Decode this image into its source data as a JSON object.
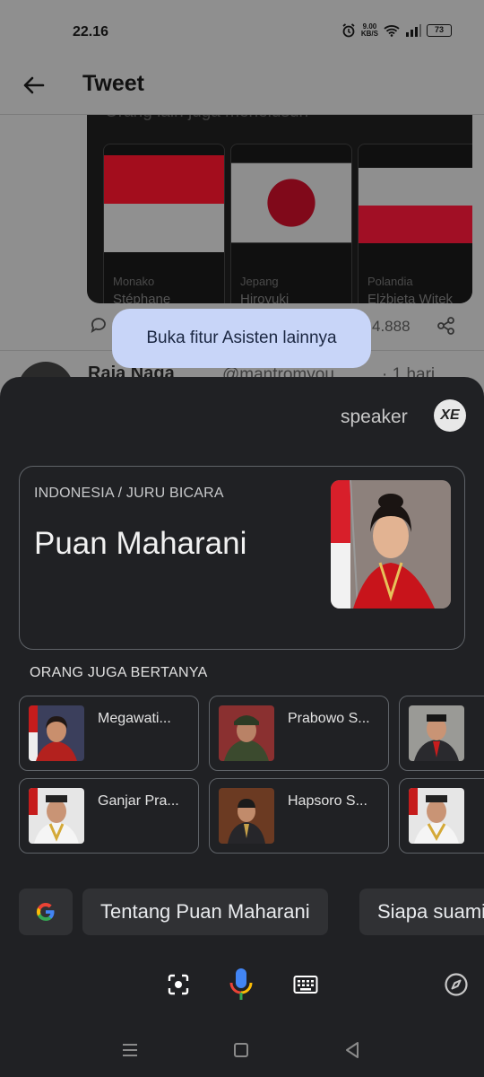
{
  "status_bar": {
    "time": "22.16",
    "net_speed_value": "9.00",
    "net_speed_unit": "KB/S",
    "battery": "73"
  },
  "top_bar": {
    "title": "Tweet"
  },
  "related_card": {
    "title": "Orang lain juga menelusuri",
    "items": [
      {
        "country": "Monako",
        "person": "Stéphane"
      },
      {
        "country": "Jepang",
        "person": "Hiroyuki"
      },
      {
        "country": "Polandia",
        "person": "Elżbieta Witek"
      }
    ]
  },
  "tweet_actions": {
    "views": "4.888"
  },
  "next_tweet": {
    "name": "Raja Naga",
    "handle": "@mantromyou",
    "time": "· 1 hari"
  },
  "tooltip": {
    "text": "Buka fitur Asisten lainnya"
  },
  "assistant": {
    "speaker_label": "speaker",
    "avatar_initials": "XE",
    "knowledge_panel": {
      "subtitle_country": "INDONESIA",
      "subtitle_role": "/ JURU BICARA",
      "name": "Puan Maharani"
    },
    "people_also_ask": {
      "title": "ORANG JUGA BERTANYA",
      "items": [
        {
          "label": "Megawati..."
        },
        {
          "label": "Prabowo S..."
        },
        {
          "label": ""
        },
        {
          "label": "Ganjar Pra..."
        },
        {
          "label": "Hapsoro S..."
        },
        {
          "label": ""
        }
      ]
    },
    "suggestions": [
      "Tentang Puan Maharani",
      "Siapa suami"
    ],
    "tools": [
      "lens-icon",
      "mic-icon",
      "keyboard-icon",
      "compass-icon"
    ],
    "colors": {
      "sheet_bg": "#202124",
      "chip_bg": "#303134",
      "tooltip_bg": "#c8d5f8"
    }
  }
}
